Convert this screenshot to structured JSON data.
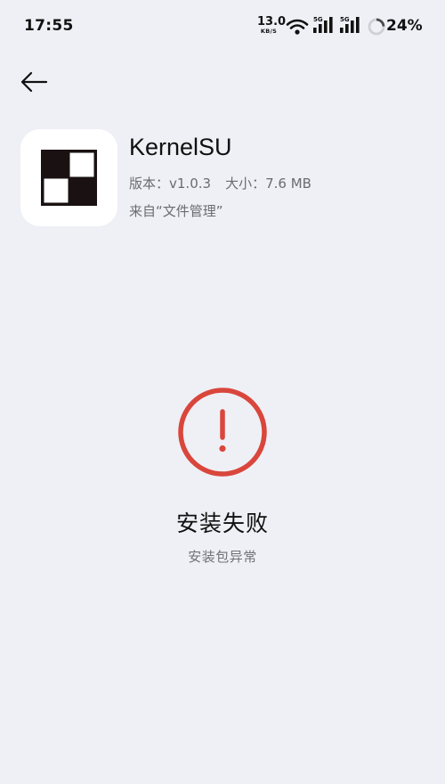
{
  "status_bar": {
    "time": "17:55",
    "net_speed_value": "13.0",
    "net_speed_unit": "KB/S",
    "wifi_icon": "wifi-icon",
    "signal_1_label": "5G",
    "signal_2_label": "5G",
    "battery_percent": "24%",
    "battery_level": 0.24
  },
  "nav": {
    "back_icon": "arrow-left-icon"
  },
  "app": {
    "name": "KernelSU",
    "version_label": "版本：",
    "version": "v1.0.3",
    "size_label": "大小：",
    "size": "7.6 MB",
    "source": "来自“文件管理”"
  },
  "result": {
    "icon": "error-exclamation-icon",
    "title": "安装失败",
    "subtitle": "安装包异常"
  },
  "colors": {
    "background": "#eff0f5",
    "error_red": "#d9463c",
    "secondary_text": "#6b6b70",
    "battery_ring_fill": "#4a4a4a",
    "battery_ring_track": "#cfcfd4"
  }
}
